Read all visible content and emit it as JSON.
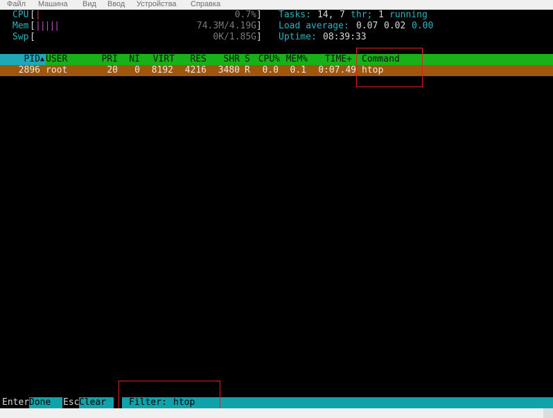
{
  "menu": [
    "Файл",
    "Машина",
    "Вид",
    "Ввод",
    "Устройства",
    "Справка"
  ],
  "meters": {
    "cpu": {
      "label": "CPU",
      "open": "[",
      "bar": "|",
      "value": "0.7%",
      "close": "]"
    },
    "mem": {
      "label": "Mem",
      "open": "[",
      "bar": "|||||",
      "value": "74.3M/4.19G",
      "close": "]"
    },
    "swp": {
      "label": "Swp",
      "open": "[",
      "bar": "",
      "value": "0K/1.85G",
      "close": "]"
    }
  },
  "stats": {
    "tasks_label": "Tasks:",
    "tasks_count": "14,",
    "thr_count": "7",
    "thr_label": "thr;",
    "running_count": "1",
    "running_label": "running",
    "load_label": "Load average:",
    "load1": "0.07",
    "load5": "0.02",
    "load15": "0.00",
    "uptime_label": "Uptime:",
    "uptime_value": "08:39:33"
  },
  "table": {
    "columns": [
      "PID",
      "USER",
      "PRI",
      "NI",
      "VIRT",
      "RES",
      "SHR",
      "S",
      "CPU%",
      "MEM%",
      "TIME+",
      "Command"
    ],
    "sort_marker": "▲",
    "rows": [
      {
        "pid": "2896",
        "user": "root",
        "pri": "20",
        "ni": "0",
        "virt": "8192",
        "res": "4216",
        "shr": "3480",
        "s": "R",
        "cpu": "0.0",
        "mem": "0.1",
        "time": "0:07.49",
        "command": "htop"
      }
    ]
  },
  "footer": {
    "enter_key": "Enter",
    "enter_action": "Done",
    "esc_key": "Esc",
    "esc_action": "Clear",
    "filter_label": "Filter:",
    "filter_value": "htop"
  }
}
